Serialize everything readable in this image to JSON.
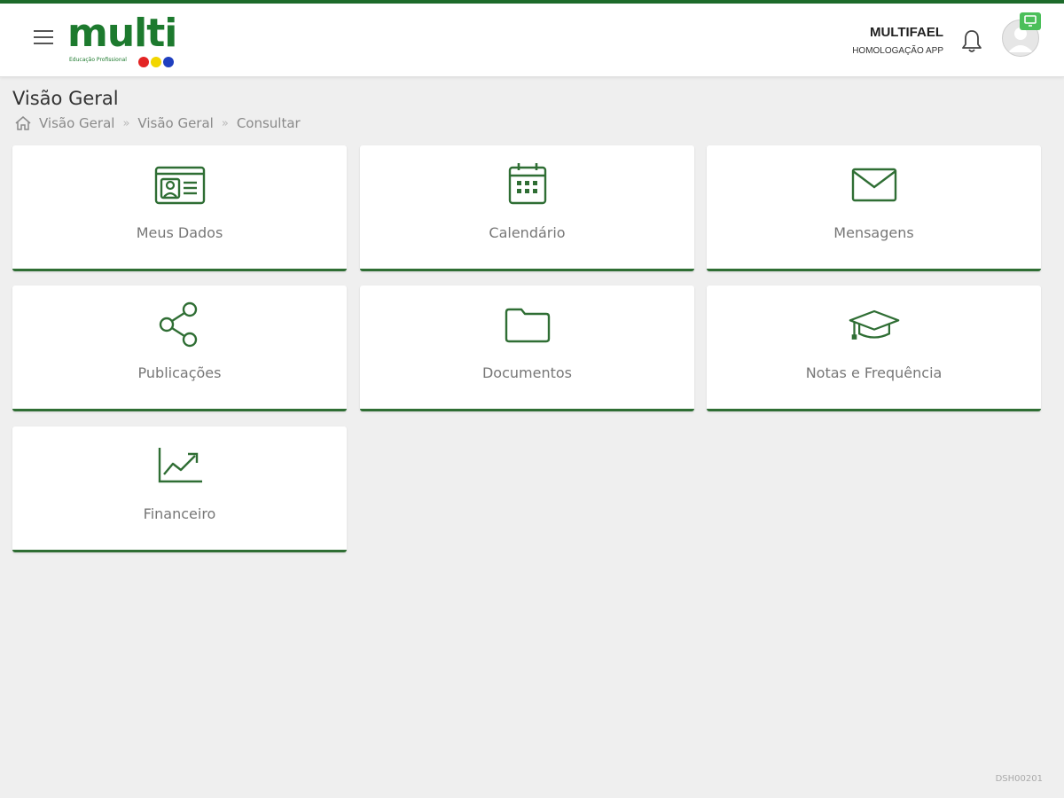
{
  "header": {
    "user_name": "MULTIFAEL",
    "user_env": "HOMOLOGAÇÃO APP",
    "logo_text": "multi",
    "logo_subtitle": "Educação Profissional",
    "logo_dot_colors": [
      "#e32424",
      "#f2d600",
      "#1f3fbf"
    ],
    "icons": {
      "menu": "hamburger-menu-icon",
      "bell": "bell-icon",
      "avatar": "user-avatar-icon",
      "badge": "monitor-icon"
    }
  },
  "page": {
    "title": "Visão Geral",
    "breadcrumb": [
      "Visão Geral",
      "Visão Geral",
      "Consultar"
    ]
  },
  "cards": [
    {
      "label": "Meus Dados",
      "icon": "id-card-icon"
    },
    {
      "label": "Calendário",
      "icon": "calendar-icon"
    },
    {
      "label": "Mensagens",
      "icon": "envelope-icon"
    },
    {
      "label": "Publicações",
      "icon": "share-icon"
    },
    {
      "label": "Documentos",
      "icon": "folder-icon"
    },
    {
      "label": "Notas e Frequência",
      "icon": "graduation-cap-icon"
    },
    {
      "label": "Financeiro",
      "icon": "trending-up-chart-icon"
    }
  ],
  "footer": {
    "code": "DSH00201"
  },
  "colors": {
    "accent": "#2f6e34",
    "brand_green": "#1d7a2e",
    "background": "#efefef",
    "badge_green": "#4bbf5a"
  }
}
